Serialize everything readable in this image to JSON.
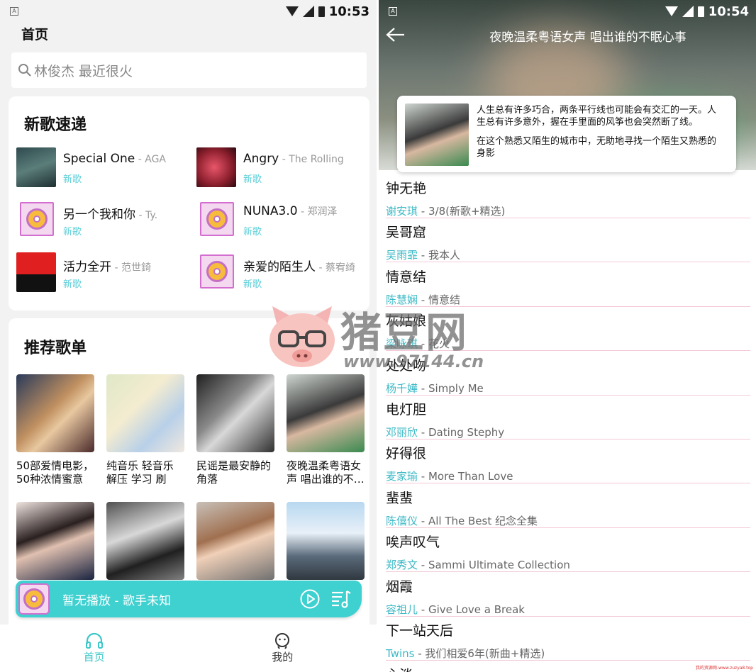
{
  "left": {
    "status": {
      "time": "10:53"
    },
    "title": "首页",
    "search_placeholder": "林俊杰 最近很火",
    "new_songs": {
      "heading": "新歌速递",
      "items": [
        {
          "title": "Special One",
          "artist": "AGA",
          "badge": "新歌",
          "cover": "photo-dark-teal"
        },
        {
          "title": "Angry",
          "artist": "The Rolling",
          "badge": "新歌",
          "cover": "photo-red"
        },
        {
          "title": "另一个我和你",
          "artist": "Ty.",
          "badge": "新歌",
          "cover": "record-icon"
        },
        {
          "title": "NUNA3.0",
          "artist": "郑润泽",
          "badge": "新歌",
          "cover": "record-icon"
        },
        {
          "title": "活力全开",
          "artist": "范世錡",
          "badge": "新歌",
          "cover": "photo-red-black"
        },
        {
          "title": "亲爱的陌生人",
          "artist": "蔡宥绮",
          "badge": "新歌",
          "cover": "record-icon"
        }
      ]
    },
    "playlists": {
      "heading": "推荐歌单",
      "items": [
        {
          "name": "50部爱情电影，50种浓情蜜意"
        },
        {
          "name": "纯音乐 轻音乐 解压 学习 刷题…"
        },
        {
          "name": "民谣是最安静的角落"
        },
        {
          "name": "夜晚温柔粤语女声 唱出谁的不…"
        },
        {
          "name": ""
        },
        {
          "name": ""
        },
        {
          "name": ""
        },
        {
          "name": ""
        }
      ]
    },
    "player": {
      "text": "暂无播放 - 歌手未知"
    },
    "nav": {
      "home": "首页",
      "me": "我的"
    }
  },
  "right": {
    "status": {
      "time": "10:54"
    },
    "title": "夜晚温柔粤语女声 唱出谁的不眠心事",
    "description": [
      "人生总有许多巧合，两条平行线也可能会有交汇的一天。人生总有许多意外，握在手里面的风筝也会突然断了线。",
      "在这个熟悉又陌生的城市中，无助地寻找一个陌生又熟悉的身影"
    ],
    "tracks": [
      {
        "name": "钟无艳",
        "singer": "谢安琪",
        "album": "3/8(新歌+精选)"
      },
      {
        "name": "吴哥窟",
        "singer": "吴雨霏",
        "album": "我本人"
      },
      {
        "name": "情意结",
        "singer": "陈慧娴",
        "album": "情意结"
      },
      {
        "name": "灰姑娘",
        "singer": "梁咏琪",
        "album": "花火"
      },
      {
        "name": "处处吻",
        "singer": "杨千嬅",
        "album": "Simply Me"
      },
      {
        "name": "电灯胆",
        "singer": "邓丽欣",
        "album": "Dating Stephy"
      },
      {
        "name": "好得很",
        "singer": "麦家瑜",
        "album": "More Than Love"
      },
      {
        "name": "蜚蜚",
        "singer": "陈僖仪",
        "album": "All The Best 纪念全集"
      },
      {
        "name": "唉声叹气",
        "singer": "郑秀文",
        "album": "Sammi Ultimate Collection"
      },
      {
        "name": "烟霞",
        "singer": "容祖儿",
        "album": "Give Love a Break"
      },
      {
        "name": "下一站天后",
        "singer": "Twins",
        "album": "我们相爱6年(新曲+精选)"
      },
      {
        "name": "心淡",
        "singer": "",
        "album": ""
      }
    ]
  },
  "watermark": {
    "text": "猪豆网",
    "url": "www.97144.cn",
    "corner": "我的资源网-www.zuzya8.top"
  },
  "colors": {
    "accent": "#3cc7c9",
    "player_bg": "#3fd0d0",
    "badge": "#5ccfd8"
  }
}
